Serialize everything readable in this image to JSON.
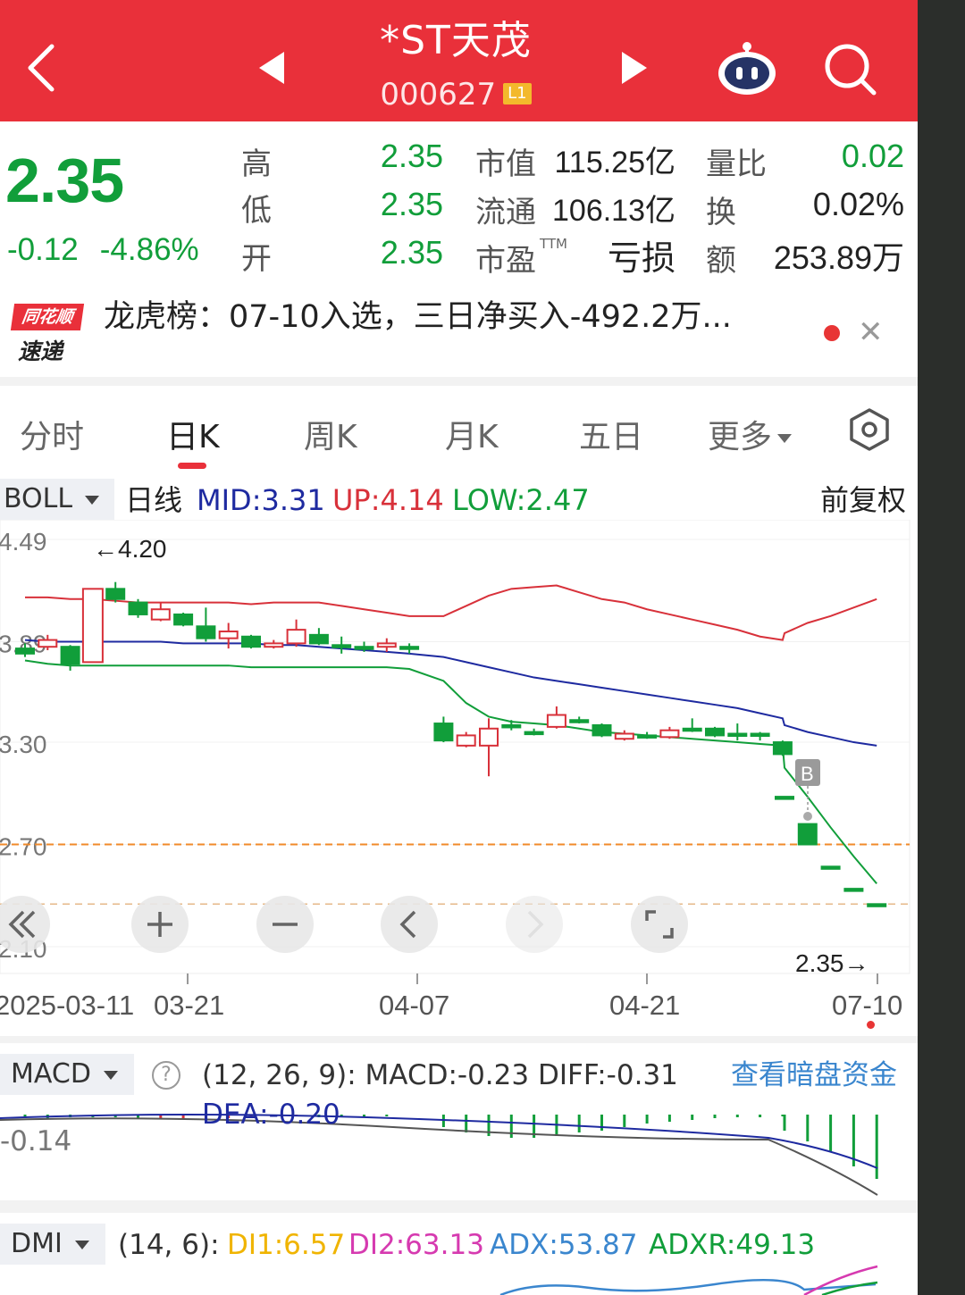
{
  "header": {
    "title": "*ST天茂",
    "code": "000627",
    "level_badge": "L1"
  },
  "quote": {
    "price": "2.35",
    "change": "-0.12",
    "change_pct": "-4.86%",
    "high_label": "高",
    "high": "2.35",
    "low_label": "低",
    "low": "2.35",
    "open_label": "开",
    "open": "2.35",
    "mktcap_label": "市值",
    "mktcap": "115.25亿",
    "float_label": "流通",
    "float": "106.13亿",
    "pe_label": "市盈",
    "pe_sup": "TTM",
    "pe": "亏损",
    "volratio_label": "量比",
    "volratio": "0.02",
    "turnover_label": "换",
    "turnover": "0.02%",
    "amount_label": "额",
    "amount": "253.89万"
  },
  "news": {
    "logo_top": "同花顺",
    "logo_bottom": "速递",
    "text": "龙虎榜：07-10入选，三日净买入-492.2万..."
  },
  "tabs": [
    "分时",
    "日K",
    "周K",
    "月K",
    "五日",
    "更多"
  ],
  "active_tab": "日K",
  "main_chart": {
    "indicator": "BOLL",
    "period": "日线",
    "mid_label": "MID:3.31",
    "up_label": "UP:4.14",
    "low_label": "LOW:2.47",
    "adjust": "前复权",
    "y_ticks": [
      "4.49",
      "3.89",
      "3.30",
      "2.70",
      "2.10"
    ],
    "max_marker": "←4.20",
    "last_marker": "2.35→",
    "buy_marker": "B",
    "dates": [
      "2025-03-11",
      "03-21",
      "04-07",
      "04-21",
      "07-10"
    ]
  },
  "chart_data": {
    "type": "candlestick",
    "x": [
      "2025-03-11",
      "03-21",
      "04-07",
      "04-21",
      "07-10"
    ],
    "ylim": [
      2.1,
      4.49
    ],
    "candles": [
      {
        "o": 3.85,
        "c": 3.82,
        "h": 3.88,
        "l": 3.8
      },
      {
        "o": 3.86,
        "c": 3.9,
        "h": 3.93,
        "l": 3.84
      },
      {
        "o": 3.86,
        "c": 3.76,
        "h": 3.87,
        "l": 3.72
      },
      {
        "o": 3.77,
        "c": 4.2,
        "h": 4.2,
        "l": 3.77
      },
      {
        "o": 4.2,
        "c": 4.14,
        "h": 4.24,
        "l": 4.12
      },
      {
        "o": 4.12,
        "c": 4.05,
        "h": 4.14,
        "l": 4.03
      },
      {
        "o": 4.02,
        "c": 4.08,
        "h": 4.12,
        "l": 4.01
      },
      {
        "o": 4.05,
        "c": 3.99,
        "h": 4.06,
        "l": 3.98
      },
      {
        "o": 3.98,
        "c": 3.91,
        "h": 4.09,
        "l": 3.89
      },
      {
        "o": 3.91,
        "c": 3.95,
        "h": 4.0,
        "l": 3.85
      },
      {
        "o": 3.92,
        "c": 3.86,
        "h": 3.93,
        "l": 3.85
      },
      {
        "o": 3.86,
        "c": 3.88,
        "h": 3.9,
        "l": 3.85
      },
      {
        "o": 3.88,
        "c": 3.96,
        "h": 4.02,
        "l": 3.86
      },
      {
        "o": 3.93,
        "c": 3.88,
        "h": 3.97,
        "l": 3.87
      },
      {
        "o": 3.87,
        "c": 3.87,
        "h": 3.92,
        "l": 3.82
      },
      {
        "o": 3.86,
        "c": 3.86,
        "h": 3.89,
        "l": 3.83
      },
      {
        "o": 3.86,
        "c": 3.88,
        "h": 3.91,
        "l": 3.83
      },
      {
        "o": 3.86,
        "c": 3.86,
        "h": 3.88,
        "l": 3.82
      },
      {
        "o": 3.41,
        "c": 3.31,
        "h": 3.45,
        "l": 3.3
      },
      {
        "o": 3.28,
        "c": 3.34,
        "h": 3.36,
        "l": 3.27
      },
      {
        "o": 3.28,
        "c": 3.38,
        "h": 3.44,
        "l": 3.1
      },
      {
        "o": 3.4,
        "c": 3.4,
        "h": 3.43,
        "l": 3.37
      },
      {
        "o": 3.36,
        "c": 3.36,
        "h": 3.38,
        "l": 3.34
      },
      {
        "o": 3.39,
        "c": 3.46,
        "h": 3.51,
        "l": 3.38
      },
      {
        "o": 3.43,
        "c": 3.43,
        "h": 3.45,
        "l": 3.41
      },
      {
        "o": 3.4,
        "c": 3.34,
        "h": 3.41,
        "l": 3.33
      },
      {
        "o": 3.32,
        "c": 3.35,
        "h": 3.37,
        "l": 3.31
      },
      {
        "o": 3.34,
        "c": 3.34,
        "h": 3.36,
        "l": 3.32
      },
      {
        "o": 3.33,
        "c": 3.37,
        "h": 3.39,
        "l": 3.32
      },
      {
        "o": 3.38,
        "c": 3.38,
        "h": 3.44,
        "l": 3.36
      },
      {
        "o": 3.38,
        "c": 3.34,
        "h": 3.39,
        "l": 3.33
      },
      {
        "o": 3.35,
        "c": 3.35,
        "h": 3.41,
        "l": 3.31
      },
      {
        "o": 3.35,
        "c": 3.35,
        "h": 3.36,
        "l": 3.31
      },
      {
        "o": 3.3,
        "c": 3.23,
        "h": 3.31,
        "l": 3.22
      },
      {
        "o": 2.98,
        "c": 2.98,
        "h": 2.98,
        "l": 2.98
      },
      {
        "o": 2.82,
        "c": 2.7,
        "h": 2.82,
        "l": 2.7
      },
      {
        "o": 2.57,
        "c": 2.57,
        "h": 2.57,
        "l": 2.57
      },
      {
        "o": 2.44,
        "c": 2.44,
        "h": 2.44,
        "l": 2.44
      },
      {
        "o": 2.35,
        "c": 2.35,
        "h": 2.35,
        "l": 2.35
      }
    ],
    "series": [
      {
        "name": "UP",
        "values": [
          4.15,
          4.15,
          4.14,
          4.14,
          4.13,
          4.12,
          4.12,
          4.12,
          4.12,
          4.12,
          4.11,
          4.12,
          4.12,
          4.12,
          4.1,
          4.08,
          4.06,
          4.04,
          4.04,
          4.1,
          4.16,
          4.2,
          4.21,
          4.22,
          4.18,
          4.14,
          4.12,
          4.08,
          4.05,
          4.02,
          3.99,
          3.96,
          3.92,
          3.9,
          3.94,
          4.0,
          4.04,
          4.09,
          4.14
        ]
      },
      {
        "name": "MID",
        "values": [
          3.9,
          3.89,
          3.89,
          3.89,
          3.89,
          3.89,
          3.89,
          3.88,
          3.88,
          3.88,
          3.88,
          3.87,
          3.87,
          3.86,
          3.85,
          3.84,
          3.83,
          3.82,
          3.8,
          3.77,
          3.74,
          3.71,
          3.68,
          3.66,
          3.64,
          3.62,
          3.6,
          3.58,
          3.56,
          3.54,
          3.52,
          3.5,
          3.47,
          3.44,
          3.4,
          3.36,
          3.33,
          3.3,
          3.28
        ]
      },
      {
        "name": "LOW",
        "values": [
          3.78,
          3.76,
          3.75,
          3.75,
          3.75,
          3.75,
          3.75,
          3.75,
          3.75,
          3.75,
          3.74,
          3.74,
          3.74,
          3.74,
          3.74,
          3.74,
          3.74,
          3.73,
          3.66,
          3.53,
          3.45,
          3.42,
          3.41,
          3.4,
          3.38,
          3.36,
          3.35,
          3.34,
          3.33,
          3.32,
          3.31,
          3.3,
          3.29,
          3.28,
          3.15,
          2.98,
          2.8,
          2.63,
          2.47
        ]
      }
    ],
    "reference_line": 2.7
  },
  "macd": {
    "indicator": "MACD",
    "params": "(12, 26, 9):",
    "macd": "MACD:-0.23",
    "diff": "DIFF:-0.31",
    "dea": "DEA:-0.20",
    "link": "查看暗盘资金",
    "y_tick": "-0.14"
  },
  "dmi": {
    "indicator": "DMI",
    "params": "(14, 6):",
    "di1": "DI1:6.57",
    "di2": "DI2:63.13",
    "adx": "ADX:53.87",
    "adxr": "ADXR:49.13"
  },
  "colors": {
    "header": "#e9303a",
    "up": "#d8313a",
    "down": "#119e3a",
    "mid": "#1e2aa0",
    "di1": "#f0b400",
    "di2": "#d63ab0",
    "adx": "#3a86ce",
    "adxr": "#119e3a"
  }
}
